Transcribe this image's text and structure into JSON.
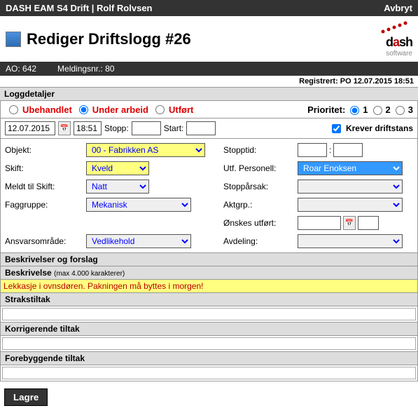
{
  "topbar": {
    "left": "DASH EAM S4 Drift | Rolf Rolvsen",
    "right": "Avbryt"
  },
  "title": "Rediger Driftslogg #26",
  "logo": {
    "text": "dash",
    "sub": "software"
  },
  "infobar": {
    "ao_label": "AO:",
    "ao_value": "642",
    "meld_label": "Meldingsnr.:",
    "meld_value": "80"
  },
  "registered": "Registrert: PO 12.07.2015 18:51",
  "sections": {
    "loggdetaljer": "Loggdetaljer",
    "beskrivelser": "Beskrivelser og forslag",
    "beskrivelse": "Beskrivelse",
    "beskrivelse_note": "(max 4.000 karakterer)",
    "strakstiltak": "Strakstiltak",
    "korrigerende": "Korrigerende tiltak",
    "forebyggende": "Forebyggende tiltak"
  },
  "status": {
    "ubehandlet": "Ubehandlet",
    "under_arbeid": "Under arbeid",
    "utfort": "Utført",
    "prioritet_label": "Prioritet:",
    "p1": "1",
    "p2": "2",
    "p3": "3"
  },
  "date_row": {
    "date": "12.07.2015",
    "time": "18:51",
    "stopp_label": "Stopp:",
    "start_label": "Start:",
    "krever": "Krever driftstans"
  },
  "form": {
    "objekt_label": "Objekt:",
    "objekt_value": "00 - Fabrikken AS",
    "skift_label": "Skift:",
    "skift_value": "Kveld",
    "meldt_label": "Meldt til Skift:",
    "meldt_value": "Natt",
    "faggruppe_label": "Faggruppe:",
    "faggruppe_value": "Mekanisk",
    "ansvar_label": "Ansvarsområde:",
    "ansvar_value": "Vedlikehold",
    "stopptid_label": "Stopptid:",
    "utf_label": "Utf. Personell:",
    "utf_value": "Roar Enoksen",
    "stopparsak_label": "Stoppårsak:",
    "aktgrp_label": "Aktgrp.:",
    "onskes_label": "Ønskes utført:",
    "avdeling_label": "Avdeling:"
  },
  "beskrivelse_text": "Lekkasje i ovnsdøren. Pakningen må byttes i morgen!",
  "save_label": "Lagre"
}
